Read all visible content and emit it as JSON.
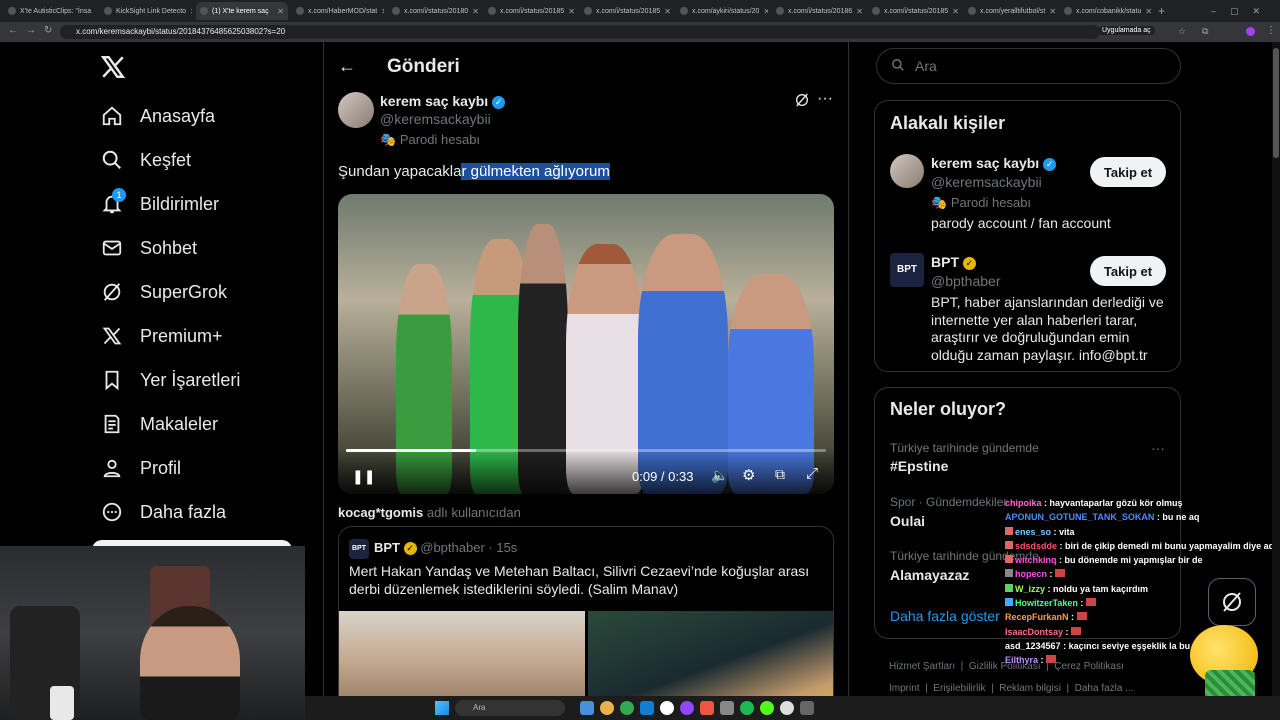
{
  "browser": {
    "tabs": [
      "X'te AutisticClips: \"İnsa",
      "KickSight Link Detecto",
      "(1) X'te kerem saç",
      "x.com/HaberMOD/stat",
      "x.com/i/status/20180",
      "x.com/i/status/20185",
      "x.com/i/status/20185",
      "x.com/aykiri/status/20",
      "x.com/i/status/20186",
      "x.com/i/status/20185",
      "x.com/yeralltifutbol/st",
      "x.com/cobanikk/statu"
    ],
    "url": "x.com/keremsackaybi/status/2018437648562503802?s=20",
    "open_in_app": "Uygulamada aç"
  },
  "sidebar": {
    "items": [
      {
        "label": "Anasayfa",
        "icon": "home-icon"
      },
      {
        "label": "Keşfet",
        "icon": "search-icon"
      },
      {
        "label": "Bildirimler",
        "icon": "bell-icon",
        "badge": "1"
      },
      {
        "label": "Sohbet",
        "icon": "mail-icon"
      },
      {
        "label": "SuperGrok",
        "icon": "grok-icon"
      },
      {
        "label": "Premium+",
        "icon": "x-logo-icon"
      },
      {
        "label": "Yer İşaretleri",
        "icon": "bookmark-icon"
      },
      {
        "label": "Makaleler",
        "icon": "article-icon"
      },
      {
        "label": "Profil",
        "icon": "person-icon"
      },
      {
        "label": "Daha fazla",
        "icon": "more-circle-icon"
      }
    ]
  },
  "header": {
    "title": "Gönderi"
  },
  "post": {
    "name": "kerem saç kaybı",
    "handle": "@keremsackaybii",
    "parody": "Parodi hesabı",
    "text_plain": "Şundan yapacakla",
    "text_selected": "r gülmekten ağlıyorum",
    "video": {
      "time": "0:09 / 0:33",
      "progress": 0.27
    }
  },
  "quoted": {
    "attribution_user": "kocag*tgomis",
    "attribution_suffix": "adlı kullanıcıdan",
    "name": "BPT",
    "handle": "@bpthaber",
    "time": "· 15s",
    "text": "Mert Hakan Yandaş ve Metehan Baltacı, Silivri Cezaevi’nde koğuşlar arası derbi düzenlemek istediklerini söyledi. (Salim Manav)"
  },
  "search": {
    "placeholder": "Ara"
  },
  "related": {
    "title": "Alakalı kişiler",
    "people": [
      {
        "name": "kerem saç kaybı",
        "handle": "@keremsackaybii",
        "parody": "Parodi hesabı",
        "bio": "parody account / fan account",
        "button": "Takip et"
      },
      {
        "name": "BPT",
        "handle": "@bpthaber",
        "bio": "BPT, haber ajanslarından derlediği ve internette yer alan haberleri tarar, araştırır ve doğruluğundan emin olduğu zaman paylaşır. info@bpt.tr",
        "button": "Takip et"
      }
    ]
  },
  "trends": {
    "title": "Neler oluyor?",
    "items": [
      {
        "context": "Türkiye tarihinde gündemde",
        "name": "#Epstine"
      },
      {
        "context": "Spor · Gündemdekiler",
        "name": "Oulai"
      },
      {
        "context": "Türkiye tarihinde gündemde",
        "name": "Alamayazaz"
      }
    ],
    "show_more": "Daha fazla göster"
  },
  "footer": {
    "links": [
      "Hizmet Şartları",
      "Gizlilik Politikası",
      "Çerez Politikası",
      "Imprint",
      "Erişilebilirlik",
      "Reklam bilgisi",
      "Daha fazla ..."
    ]
  },
  "chat": {
    "messages": [
      {
        "user": "chipoika",
        "text": ": hayvantaparlar gözü kör olmuş",
        "color": "#ff6bd6"
      },
      {
        "user": "APONUN_GOTUNE_TANK_SOKAN",
        "text": ": bu ne aq",
        "color": "#4a8cff"
      },
      {
        "user": "enes_so",
        "text": ": vita",
        "color": "#7ec8ff"
      },
      {
        "user": "sdsdsdde",
        "text": ": biri de çikip demedi mi bunu yapmayalim diye aq",
        "color": "#ff4d6a"
      },
      {
        "user": "witchkinq",
        "text": ": bu dönemde mi yapmışlar bir de",
        "color": "#ff4df0"
      },
      {
        "user": "hopecn",
        "text": ":",
        "color": "#ff4df0"
      },
      {
        "user": "W_izzy",
        "text": ": noldu ya tam kaçırdım",
        "color": "#9dff4d"
      },
      {
        "user": "HowitzerTaken",
        "text": ":",
        "color": "#4dff88"
      },
      {
        "user": "RecepFurkanN",
        "text": ":",
        "color": "#ff9a4d"
      },
      {
        "user": "IsaacDontsay",
        "text": ":",
        "color": "#ff6b8a"
      },
      {
        "user": "asd_1234567",
        "text": ": kaçıncı seviye eşşeklik la bu",
        "color": "#ffffff"
      },
      {
        "user": "Eilthyra",
        "text": ":",
        "color": "#c38cff"
      }
    ]
  },
  "taskbar": {
    "search": "Ara"
  },
  "colors": {
    "accent": "#1d9bf0",
    "selection": "#1d4f9c",
    "follow_bg": "#eff3f4"
  }
}
